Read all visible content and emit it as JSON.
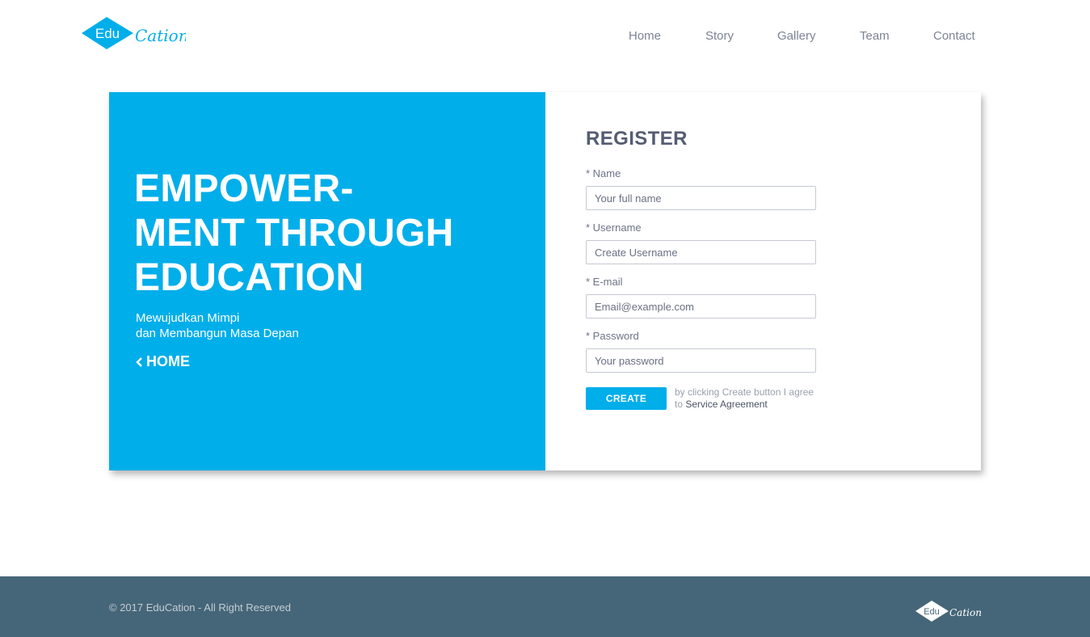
{
  "brand": {
    "logo_badge": "Edu",
    "logo_script": "Cation",
    "primary_color": "#00aeea",
    "footer_color": "#456678"
  },
  "nav": {
    "items": [
      {
        "label": "Home"
      },
      {
        "label": "Story"
      },
      {
        "label": "Gallery"
      },
      {
        "label": "Team"
      },
      {
        "label": "Contact"
      }
    ]
  },
  "hero": {
    "title_lines": [
      "EMPOWER-",
      "MENT THROUGH",
      "EDUCATION"
    ],
    "subtitle_lines": [
      "Mewujudkan Mimpi",
      "dan Membangun Masa Depan"
    ],
    "home_link": "HOME",
    "home_icon": "chevron-left-icon"
  },
  "form": {
    "title": "REGISTER",
    "fields": [
      {
        "label": "* Name",
        "placeholder": "Your full name",
        "value": ""
      },
      {
        "label": "* Username",
        "placeholder": "Create Username",
        "value": ""
      },
      {
        "label": "* E-mail",
        "placeholder": "Email@example.com",
        "value": ""
      },
      {
        "label": "* Password",
        "placeholder": "Your password",
        "value": ""
      }
    ],
    "submit_label": "CREATE",
    "agree_text": "by clicking Create button I agree to",
    "agree_link": "Service Agreement"
  },
  "footer": {
    "copyright": "© 2017 EduCation - All Right Reserved"
  }
}
